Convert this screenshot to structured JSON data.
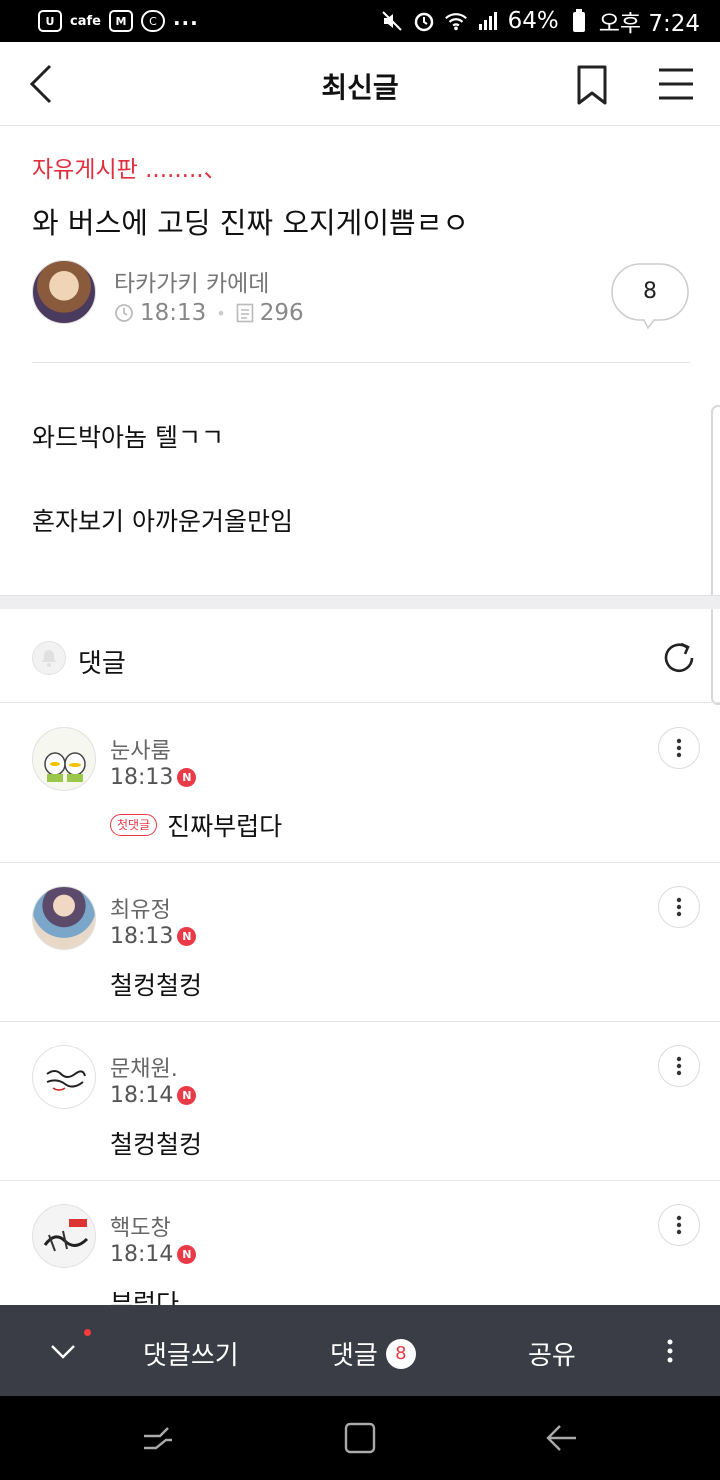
{
  "status_bar": {
    "app_badge": "U",
    "cafe_label": "cafe",
    "mail_badge": "M",
    "c_badge": "C",
    "more": "...",
    "battery": "64%",
    "time": "오후 7:24"
  },
  "nav": {
    "title": "최신글"
  },
  "post": {
    "board": "자유게시판 ........、",
    "title": "와 버스에 고딩 진짜 오지게이쁨ㄹㅇ",
    "author": "타카가키 카에데",
    "time": "18:13",
    "views": "296",
    "comment_count": "8",
    "body": [
      "와드박아놈 텔ㄱㄱ",
      "혼자보기 아까운거올만임"
    ]
  },
  "comments_section": {
    "title": "댓글",
    "new_badge": "N",
    "first_comment_badge": "첫댓글",
    "items": [
      {
        "name": "눈사룸",
        "time": "18:13",
        "text": "진짜부럽다"
      },
      {
        "name": "최유정",
        "time": "18:13",
        "text": "철컹철컹"
      },
      {
        "name": "문채원.",
        "time": "18:14",
        "text": "철컹철컹"
      },
      {
        "name": "핵도창",
        "time": "18:14",
        "text": "부럽다"
      }
    ]
  },
  "action_bar": {
    "write": "댓글쓰기",
    "comments": "댓글",
    "count": "8",
    "share": "공유"
  },
  "colors": {
    "accent_red": "#e0303f",
    "action_bar_bg": "#3b3d46"
  }
}
